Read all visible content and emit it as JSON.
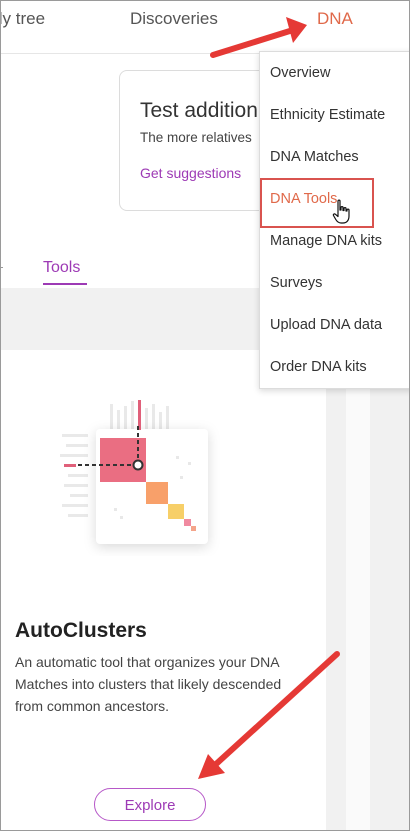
{
  "nav": {
    "family_tree": "ily tree",
    "discoveries": "Discoveries",
    "dna": "DNA"
  },
  "test_card": {
    "title": "Test addition",
    "subtitle": "The more relatives",
    "link": "Get suggestions"
  },
  "tabs": {
    "tools": "Tools"
  },
  "tool": {
    "title": "AutoClusters",
    "description": "An automatic tool that organizes your DNA Matches into clusters that likely descended from common ancestors.",
    "button": "Explore"
  },
  "dropdown": {
    "items": [
      "Overview",
      "Ethnicity Estimate",
      "DNA Matches",
      "DNA Tools",
      "Manage DNA kits",
      "Surveys",
      "Upload DNA data",
      "Order DNA kits"
    ],
    "active_index": 3
  },
  "colors": {
    "accent_purple": "#9d3ab5",
    "dna_orange": "#e0694a",
    "annotation_red": "#e53935"
  },
  "icons": [
    "hand-pointer-icon",
    "autoclusters-illustration",
    "red-arrow"
  ]
}
